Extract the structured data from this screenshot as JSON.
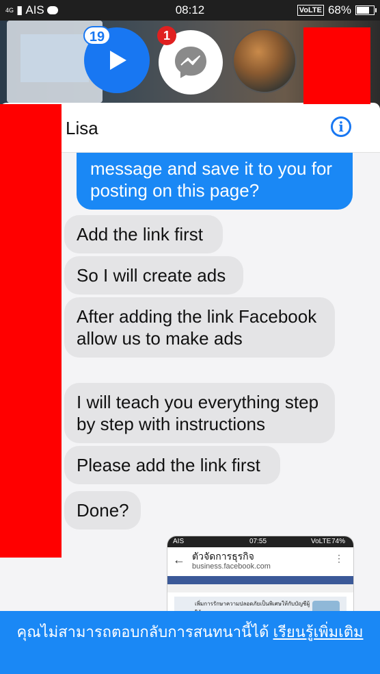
{
  "status_bar": {
    "signal_label": "4G",
    "carrier": "AIS",
    "time": "08:12",
    "volte": "VoLTE",
    "battery": "68%",
    "battery_level": 0.68
  },
  "chat_heads": {
    "video_badge": "19",
    "messenger_badge": "1",
    "icons": [
      "play-icon",
      "messenger-icon"
    ]
  },
  "conversation": {
    "contact_name": "Lisa",
    "info_label": "i",
    "outgoing_partial": "message and save it to you for posting on this page?",
    "incoming": [
      "Add the link first",
      "So I will create ads",
      "After adding the link Facebook allow us to make ads",
      "I will teach you everything step by step with instructions",
      "Please add the link first",
      "Done?"
    ]
  },
  "shared_screenshot": {
    "carrier": "AIS",
    "time": "07:55",
    "volte": "VoLTE",
    "battery": "74%",
    "title": "ตัวจัดการธุรกิจ",
    "url": "business.facebook.com",
    "card_text": "เพิ่มการรักษาความปลอดภัยเป็นพิเศษให้กับบัญชีผู้ใช้ของคุณ"
  },
  "notice": {
    "text": "คุณไม่สามารถตอบกลับการสนทนานี้ได้",
    "link": "เรียนรู้เพิ่มเติม"
  },
  "colors": {
    "accent": "#1877f2",
    "outgoing_bubble": "#1a88f5",
    "incoming_bubble": "#e4e4e6",
    "redaction": "#ff0000",
    "badge_red": "#e02020"
  }
}
